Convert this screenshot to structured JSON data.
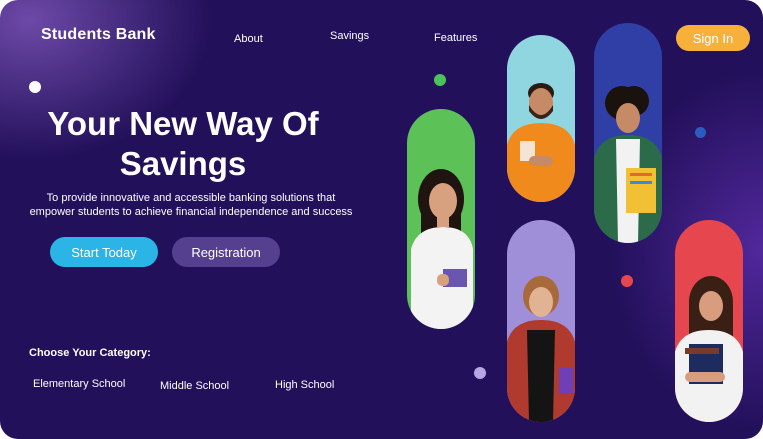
{
  "brand": {
    "name": "Students Bank"
  },
  "nav": {
    "about": "About",
    "savings": "Savings",
    "features": "Features",
    "sign_in": "Sign In"
  },
  "hero": {
    "title_line1": "Your New Way Of",
    "title_line2": "Savings",
    "subtitle_line1": "To provide innovative and accessible banking solutions that",
    "subtitle_line2": "empower students to achieve financial independence and success"
  },
  "actions": {
    "start": "Start Today",
    "register": "Registration"
  },
  "categories": {
    "title": "Choose Your Category:",
    "items": [
      "Elementary School",
      "Middle  School",
      "High  School"
    ]
  },
  "colors": {
    "background": "#22105a",
    "accent_orange": "#f7b13b",
    "accent_blue": "#2bb4e6",
    "secondary_button": "#55408f"
  },
  "photos": [
    {
      "icon": "student-photo-girl-white-shirt",
      "bg": "#5cc157"
    },
    {
      "icon": "student-photo-man-orange-sweater",
      "bg": "#8fd6e0"
    },
    {
      "icon": "student-photo-man-plaid-shirt",
      "bg": "#2f3fa6"
    },
    {
      "icon": "student-photo-woman-plaid-shirt",
      "bg": "#9f8fd8"
    },
    {
      "icon": "student-photo-woman-holding-books",
      "bg": "#e6474f"
    }
  ]
}
